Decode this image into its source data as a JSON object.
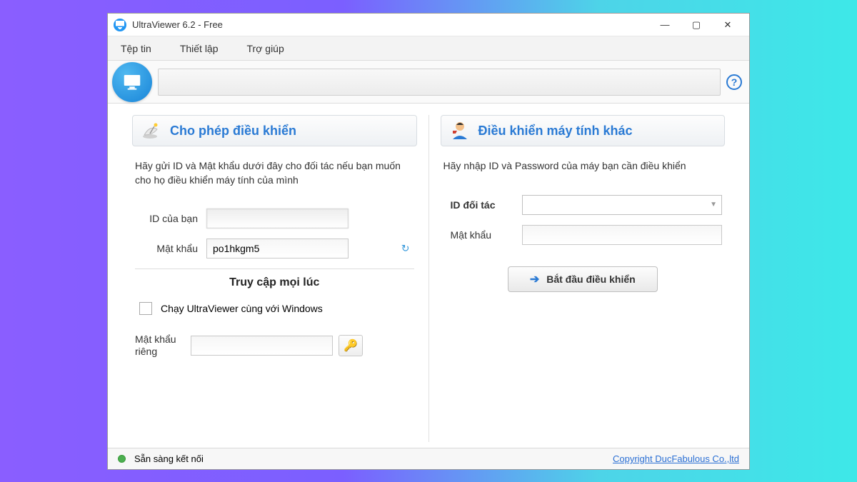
{
  "window": {
    "title": "UltraViewer 6.2 - Free"
  },
  "menu": {
    "file": "Tệp tin",
    "settings": "Thiết lập",
    "help": "Trợ giúp"
  },
  "left": {
    "header": "Cho phép điều khiển",
    "desc": "Hãy gửi ID và Mật khẩu dưới đây cho đối tác nếu bạn muốn cho họ điều khiển máy tính của mình",
    "id_label": "ID của bạn",
    "id_value": "",
    "pw_label": "Mật khẩu",
    "pw_value": "po1hkgm5",
    "anytime_header": "Truy cập mọi lúc",
    "startup_label": "Chạy UltraViewer cùng với Windows",
    "private_pw_label": "Mật khẩu riêng",
    "private_pw_value": ""
  },
  "right": {
    "header": "Điều khiển máy tính khác",
    "desc": "Hãy nhập ID và Password của máy bạn cần điều khiển",
    "partner_id_label": "ID đối tác",
    "partner_id_value": "",
    "pw_label": "Mật khẩu",
    "pw_value": "",
    "start_label": "Bắt đầu điều khiển"
  },
  "status": {
    "text": "Sẵn sàng kết nối",
    "copyright": "Copyright DucFabulous Co.,ltd"
  }
}
